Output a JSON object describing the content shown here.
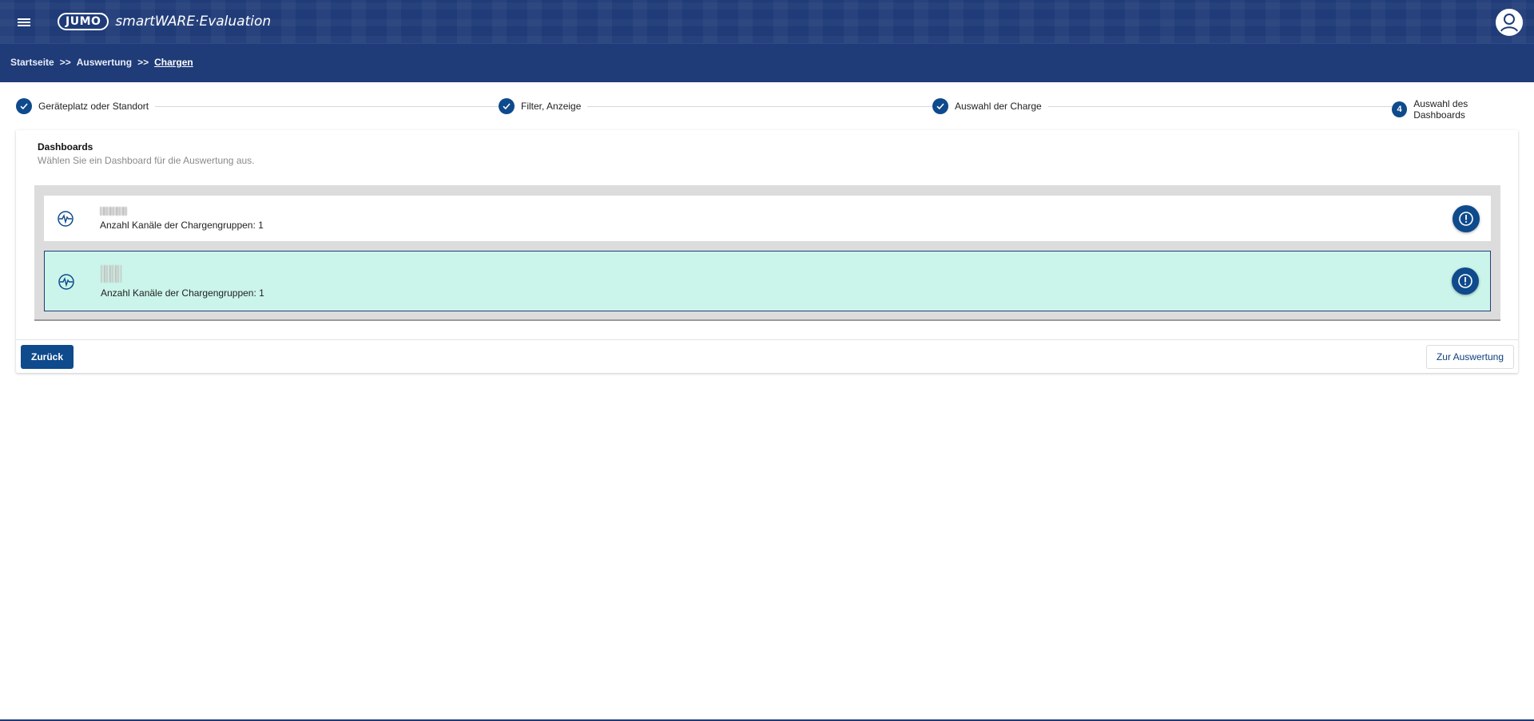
{
  "app": {
    "logo_badge": "JUMO",
    "logo_text": "smartWARE·Evaluation",
    "menu_icon": "hamburger-menu-icon",
    "avatar_icon": "user-avatar-icon"
  },
  "breadcrumb": {
    "items": [
      "Startseite",
      "Auswertung",
      "Chargen"
    ],
    "separator": ">>"
  },
  "stepper": {
    "steps": [
      {
        "label": "Geräteplatz oder Standort",
        "state": "done",
        "marker": "check-icon"
      },
      {
        "label": "Filter, Anzeige",
        "state": "done",
        "marker": "check-icon"
      },
      {
        "label": "Auswahl der Charge",
        "state": "done",
        "marker": "check-icon"
      },
      {
        "label": "Auswahl des Dashboards",
        "state": "active",
        "number": "4"
      }
    ]
  },
  "dashboards": {
    "title": "Dashboards",
    "subtitle": "Wählen Sie ein Dashboard für die Auswertung aus.",
    "items": [
      {
        "name": "████",
        "detail": "Anzahl Kanäle der Chargengruppen: 1",
        "icon": "pulse-chart-icon",
        "selected": false
      },
      {
        "name": "███",
        "detail": "Anzahl Kanäle der Chargengruppen: 1",
        "icon": "pulse-chart-icon",
        "selected": true
      }
    ],
    "info_icon": "info-alert-icon"
  },
  "actions": {
    "back_label": "Zurück",
    "next_label": "Zur Auswertung"
  },
  "colors": {
    "header": "#1f3b78",
    "primary": "#0e4a8c",
    "selected_row": "#cbf5ea"
  }
}
